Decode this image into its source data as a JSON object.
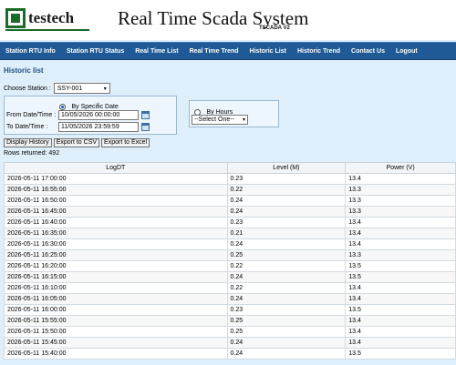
{
  "header": {
    "logo_text": "testech",
    "title": "Real Time Scada System",
    "subtitle": "TSCADA V2"
  },
  "nav": {
    "items": [
      {
        "label": "Station RTU Info"
      },
      {
        "label": "Station RTU Status"
      },
      {
        "label": "Real Time List"
      },
      {
        "label": "Real Time Trend"
      },
      {
        "label": "Historic List"
      },
      {
        "label": "Historic Trend"
      },
      {
        "label": "Contact Us"
      },
      {
        "label": "Logout"
      }
    ]
  },
  "page": {
    "title": "Historic list",
    "station_label": "Choose Station :",
    "station_value": "SSY-001",
    "by_date_label": "By Specific Date",
    "by_hours_label": "By Hours",
    "from_label": "From Date/Time :",
    "from_value": "10/05/2026 00:00:00",
    "to_label": "To Date/Time :",
    "to_value": "11/05/2026 23:59:59",
    "hours_value": "--Select One--",
    "btn_display": "Display History",
    "btn_csv": "Export to CSV",
    "btn_excel": "Export to Excel",
    "rows_returned": "Rows returned: 492"
  },
  "table": {
    "headers": [
      "LogDT",
      "Level (M)",
      "Power (V)"
    ],
    "rows": [
      [
        "2026-05-11 17:00:00",
        "0.23",
        "13.4"
      ],
      [
        "2026-05-11 16:55:00",
        "0.22",
        "13.3"
      ],
      [
        "2026-05-11 16:50:00",
        "0.24",
        "13.3"
      ],
      [
        "2026-05-11 16:45:00",
        "0.24",
        "13.3"
      ],
      [
        "2026-05-11 16:40:00",
        "0.23",
        "13.4"
      ],
      [
        "2026-05-11 16:35:00",
        "0.21",
        "13.4"
      ],
      [
        "2026-05-11 16:30:00",
        "0.24",
        "13.4"
      ],
      [
        "2026-05-11 16:25:00",
        "0.25",
        "13.3"
      ],
      [
        "2026-05-11 16:20:00",
        "0.22",
        "13.5"
      ],
      [
        "2026-05-11 16:15:00",
        "0.24",
        "13.5"
      ],
      [
        "2026-05-11 16:10:00",
        "0.22",
        "13.4"
      ],
      [
        "2026-05-11 16:05:00",
        "0.24",
        "13.4"
      ],
      [
        "2026-05-11 16:00:00",
        "0.23",
        "13.5"
      ],
      [
        "2026-05-11 15:55:00",
        "0.25",
        "13.4"
      ],
      [
        "2026-05-11 15:50:00",
        "0.25",
        "13.4"
      ],
      [
        "2026-05-11 15:45:00",
        "0.24",
        "13.4"
      ],
      [
        "2026-05-11 15:40:00",
        "0.24",
        "13.5"
      ]
    ]
  }
}
